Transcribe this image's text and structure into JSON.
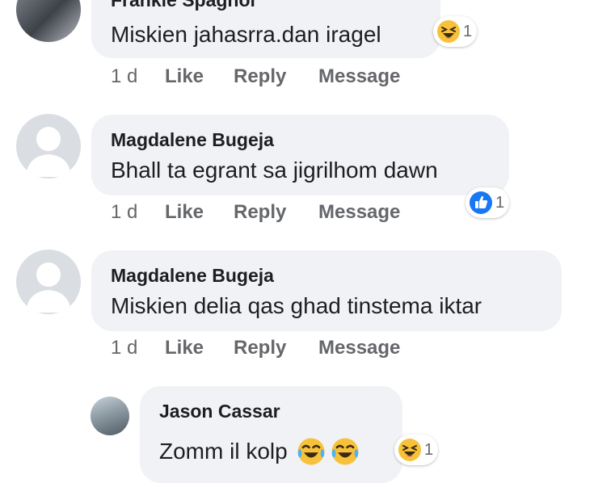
{
  "comments": [
    {
      "author": "Frankie Spagnol",
      "text": "Miskien jahasrra.dan iragel",
      "time": "1 d",
      "like": "Like",
      "reply": "Reply",
      "message": "Message",
      "reaction": {
        "icon": "laughing-emoji-icon",
        "count": "1"
      }
    },
    {
      "author": "Magdalene Bugeja",
      "text": "Bhall ta egrant sa jigrilhom dawn",
      "time": "1 d",
      "like": "Like",
      "reply": "Reply",
      "message": "Message",
      "reaction": {
        "icon": "like-thumb-icon",
        "count": "1"
      }
    },
    {
      "author": "Magdalene Bugeja",
      "text": "Miskien delia qas ghad tinstema iktar",
      "time": "1 d",
      "like": "Like",
      "reply": "Reply",
      "message": "Message"
    },
    {
      "author": "Jason Cassar",
      "text": "Zomm il kolp",
      "inline_emojis": [
        "tears-of-joy-emoji-icon",
        "tears-of-joy-emoji-icon"
      ],
      "reaction": {
        "icon": "laughing-emoji-icon",
        "count": "1"
      }
    }
  ],
  "colors": {
    "bubble": "#f0f2f5",
    "meta": "#65676b",
    "like_blue": "#1877f2",
    "emoji_yellow": "#f7c23a"
  }
}
